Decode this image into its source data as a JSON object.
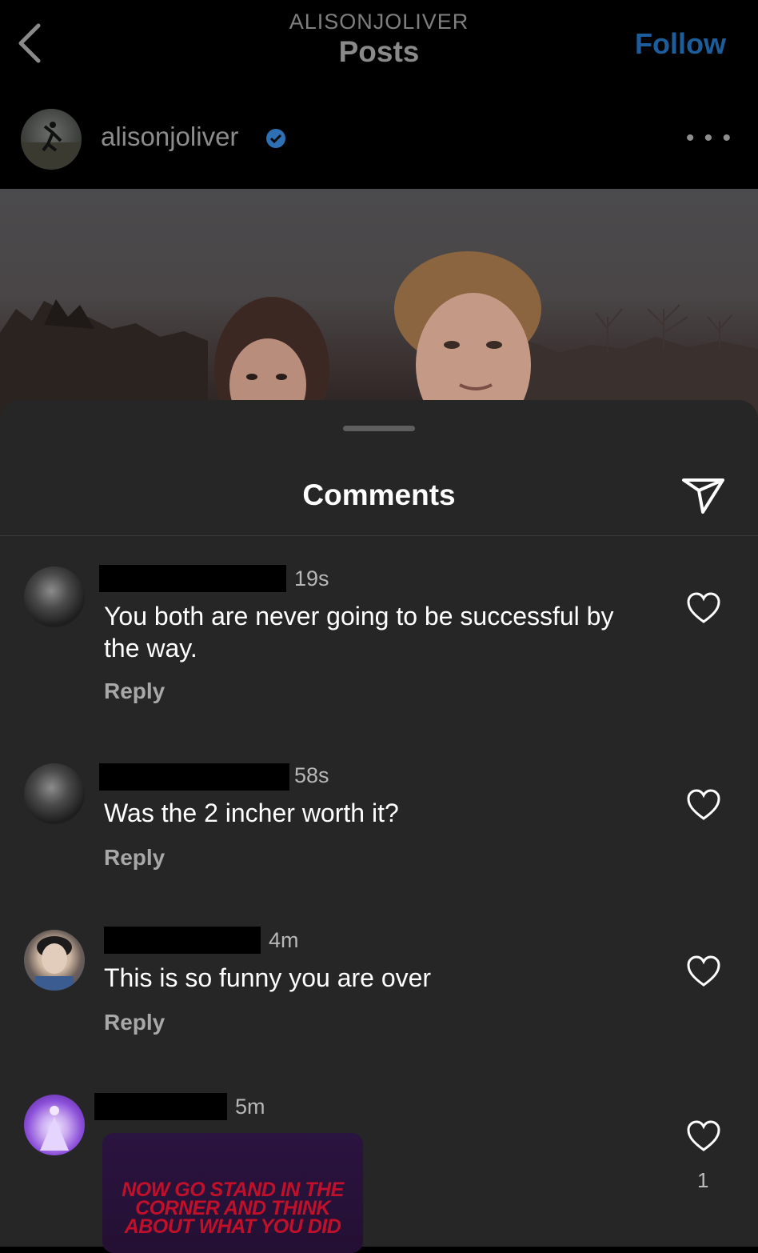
{
  "header": {
    "subtitle": "ALISONJOLIVER",
    "title": "Posts",
    "follow_label": "Follow",
    "back_icon": "chevron-left-icon"
  },
  "post": {
    "username": "alisonjoliver",
    "verified": true,
    "more_icon": "more-horizontal-icon",
    "more_label": "• • •"
  },
  "comments_sheet": {
    "title": "Comments",
    "share_icon": "send-icon",
    "comments": [
      {
        "time": "19s",
        "text": "You both are never going to be successful by the way.",
        "reply_label": "Reply"
      },
      {
        "time": "58s",
        "text": "Was the 2 incher worth it?",
        "reply_label": "Reply"
      },
      {
        "time": "4m",
        "text": "This is so funny you are over",
        "reply_label": "Reply"
      },
      {
        "time": "5m",
        "sticker_text": "NOW GO STAND IN THE CORNER AND THINK ABOUT WHAT YOU DID",
        "like_count": "1"
      }
    ]
  },
  "colors": {
    "accent": "#1c5e9c",
    "sheet_bg": "#262626",
    "verified": "#3897f0"
  }
}
